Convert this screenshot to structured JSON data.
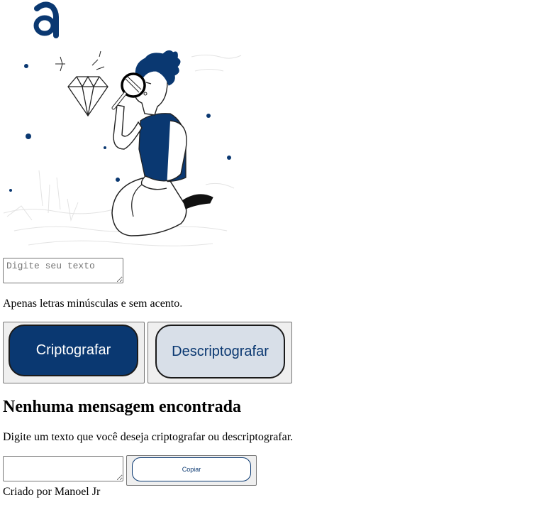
{
  "header": {
    "logo_icon": "alura-a-logo-icon"
  },
  "illustration": {
    "icon": "person-with-magnifier-diamond-illustration"
  },
  "input": {
    "placeholder": "Digite seu texto",
    "value": ""
  },
  "hint": {
    "text": "Apenas letras minúsculas e sem acento."
  },
  "buttons": {
    "encrypt_label": "Criptografar",
    "decrypt_label": "Descriptografar"
  },
  "output": {
    "title": "Nenhuma mensagem encontrada",
    "description": "Digite um texto que você deseja criptografar ou descriptografar.",
    "value": "",
    "copy_label": "Copiar"
  },
  "footer": {
    "text": "Criado por Manoel Jr"
  },
  "colors": {
    "primary": "#0a3871",
    "secondary": "#d8dfe8"
  }
}
